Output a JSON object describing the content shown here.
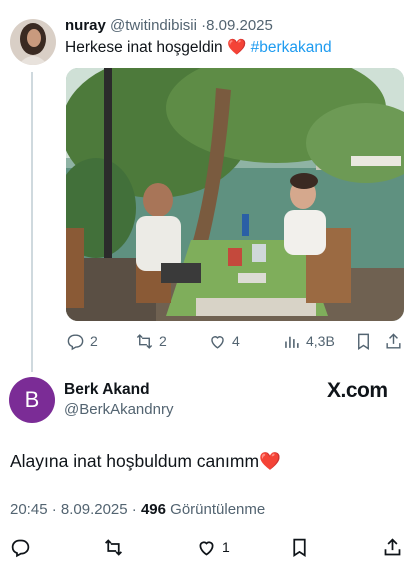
{
  "reply_tweet": {
    "name": "nuray",
    "handle": "@twitindibisii",
    "separator": "·",
    "date": "8.09.2025",
    "text_plain": "Herkese inat hoşgeldin",
    "text_emoji": "❤️",
    "hashtag": "#berkakand",
    "stats": {
      "replies": "2",
      "reposts": "2",
      "likes": "4",
      "views": "4,3B"
    }
  },
  "main_tweet": {
    "avatar_letter": "B",
    "name": "Berk Akand",
    "handle": "@BerkAkandnry",
    "brand": "X.com",
    "text": "Alayına inat hoşbuldum canımm❤️",
    "time": "20:45",
    "separator": "·",
    "date": "8.09.2025",
    "separator2": "·",
    "views_count": "496",
    "views_label": "Görüntülenme",
    "stats": {
      "likes": "1"
    }
  },
  "colors": {
    "accent": "#1d9bf0",
    "muted": "#536471",
    "avatar_purple": "#7b2c96",
    "heart": "#e0245e"
  },
  "icons": [
    "reply-icon",
    "repost-icon",
    "like-icon",
    "views-icon",
    "bookmark-icon",
    "share-icon"
  ]
}
